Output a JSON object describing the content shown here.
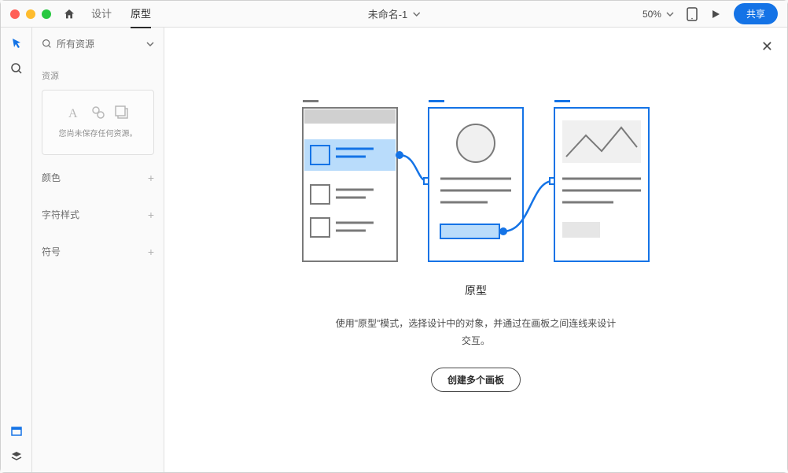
{
  "titlebar": {
    "doc_title": "未命名-1",
    "tabs": {
      "design": "设计",
      "prototype": "原型"
    },
    "zoom": "50%",
    "share": "共享"
  },
  "sidebar": {
    "search_label": "所有资源",
    "assets_label": "资源",
    "assets_empty": "您尚未保存任何资源。",
    "panel_colors": "颜色",
    "panel_char_styles": "字符样式",
    "panel_symbols": "符号"
  },
  "onboard": {
    "title": "原型",
    "desc": "使用\"原型\"模式，选择设计中的对象，并通过在画板之间连线来设计交互。",
    "button": "创建多个画板"
  }
}
